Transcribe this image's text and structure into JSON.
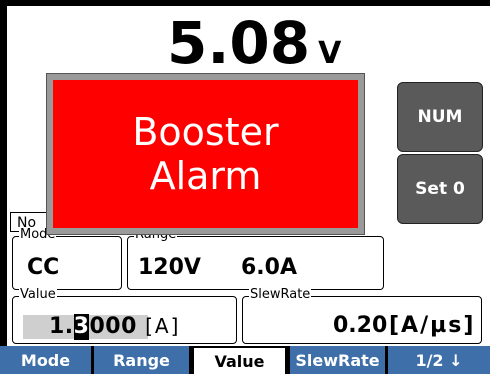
{
  "reading": {
    "value": "5.08",
    "unit": "V"
  },
  "side_buttons": {
    "num": "NUM",
    "set0": "Set 0"
  },
  "status_box": "No",
  "mode": {
    "legend": "Mode",
    "value": "CC"
  },
  "range": {
    "legend": "Range",
    "voltage": "120V",
    "current": "6.0A"
  },
  "value_field": {
    "legend": "Value",
    "prefix": "1.",
    "cursor_digit": "3",
    "suffix": "000",
    "unit": "[A]"
  },
  "slew": {
    "legend": "SlewRate",
    "value": "0.20",
    "unit": "[A/µs]"
  },
  "alarm": {
    "line1": "Booster",
    "line2": "Alarm",
    "color": "#ff0000"
  },
  "softkeys": [
    "Mode",
    "Range",
    "Value",
    "SlewRate",
    "1/2 ↓"
  ],
  "colors": {
    "softkey": "#3e6fa8",
    "side_button": "#5a5a5a"
  }
}
